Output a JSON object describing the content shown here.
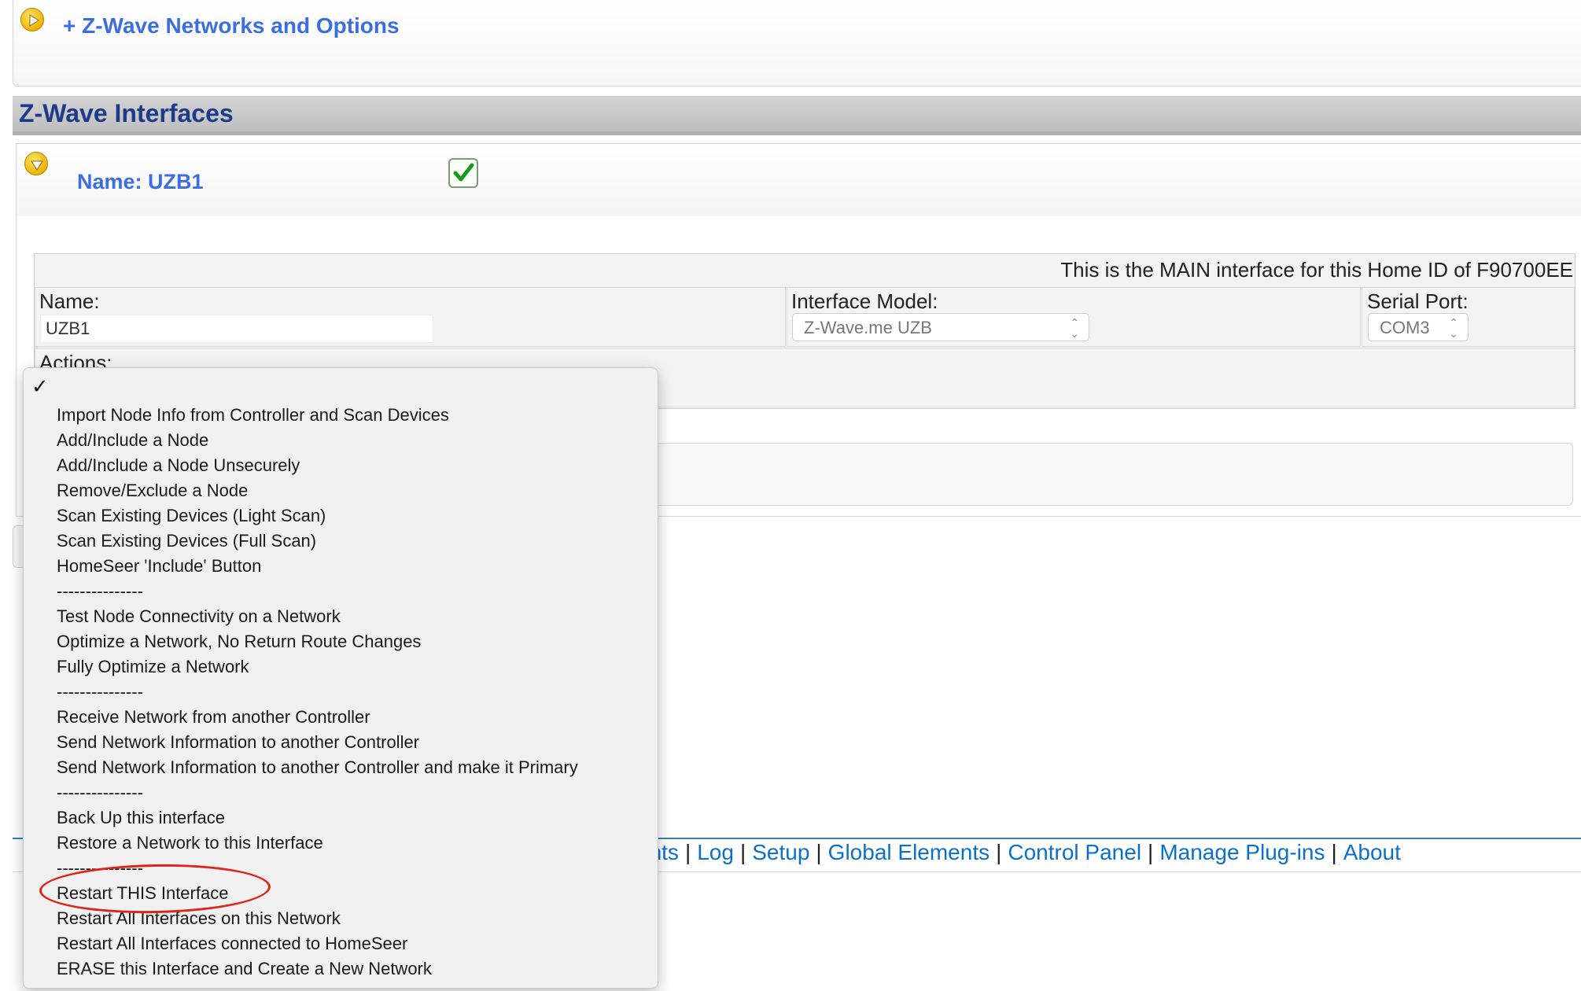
{
  "networks_panel": {
    "title": "+ Z-Wave Networks and Options"
  },
  "section": {
    "title": "Z-Wave Interfaces"
  },
  "interface": {
    "name_link": "Name: UZB1",
    "main_notice": "This is the MAIN interface for this Home ID of F90700EE",
    "name_label": "Name:",
    "name_value": "UZB1",
    "model_label": "Interface Model:",
    "model_value": "Z-Wave.me UZB",
    "port_label": "Serial Port:",
    "port_value": "COM3",
    "actions_label": "Actions:"
  },
  "footer_nav": {
    "links": [
      "ents",
      "Log",
      "Setup",
      "Global Elements",
      "Control Panel",
      "Manage Plug-ins",
      "About"
    ],
    "separator": "|"
  },
  "actions_menu": {
    "selected_check": "✓",
    "items": [
      "Import Node Info from Controller and Scan Devices",
      "Add/Include a Node",
      "Add/Include a Node Unsecurely",
      "Remove/Exclude a Node",
      "Scan Existing Devices (Light Scan)",
      "Scan Existing Devices (Full Scan)",
      "HomeSeer 'Include' Button",
      "---------------",
      "Test Node Connectivity on a Network",
      "Optimize a Network, No Return Route Changes",
      "Fully Optimize a Network",
      "---------------",
      "Receive Network from another Controller",
      "Send Network Information to another Controller",
      "Send Network Information to another Controller and make it Primary",
      "---------------",
      "Back Up this interface",
      "Restore a Network to this Interface",
      "---------------",
      "Restart THIS Interface",
      "Restart All Interfaces on this Network",
      "Restart All Interfaces connected to HomeSeer",
      "ERASE this Interface and Create a New Network"
    ],
    "highlighted_item": "Restart THIS Interface"
  },
  "colors": {
    "link_blue": "#3b6ee0",
    "section_title": "#1e3a8a",
    "nav_blue": "#0a70c8",
    "highlight_red": "#e0241b",
    "icon_yellow": "#f1b400",
    "check_green": "#1a9a1a"
  },
  "icons": {
    "networks_toggle": "play-circle-icon",
    "interface_toggle": "chevron-down-circle-icon",
    "enabled_checkbox": "checkmark-icon"
  }
}
